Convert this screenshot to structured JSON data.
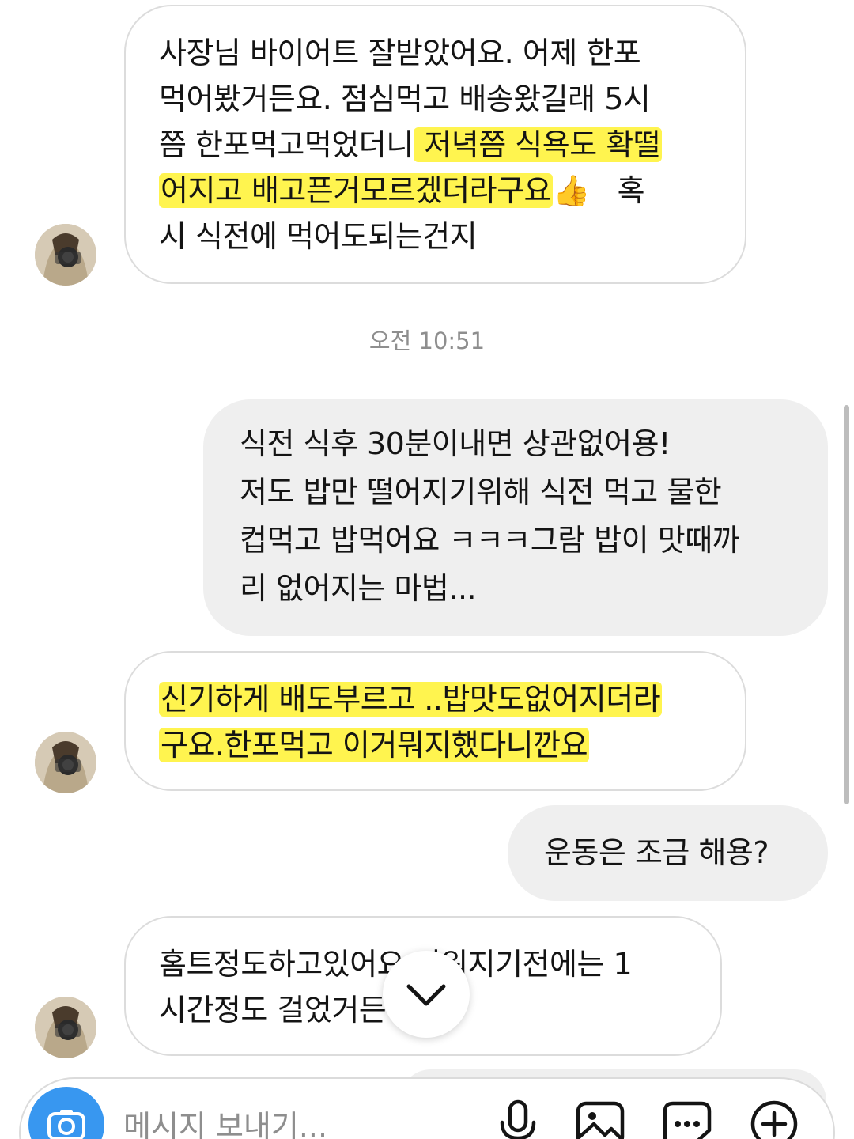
{
  "messages": [
    {
      "lines": [
        {
          "text": "사장님 바이어트 잘받았어요. 어제 한포"
        },
        {
          "text": "먹어봤거든요. 점심먹고  배송왔길래 5시"
        },
        {
          "pre": "쯤 한포먹고먹었더니",
          "hl": " 저녁쯤 식욕도 확떨"
        },
        {
          "hl": "어지고 배고픈거모르겠더라구요",
          "emoji": "👍",
          "post": "   혹"
        },
        {
          "text": "시 식전에 먹어도되는건지"
        }
      ]
    },
    {
      "lines": [
        {
          "text": "식전 식후 30분이내면 상관없어용!"
        },
        {
          "text": "저도 밥만 떨어지기위해 식전 먹고 물한"
        },
        {
          "text": "컵먹고 밥먹어요 ㅋㅋㅋ그람 밥이 맛때까"
        },
        {
          "text": "리 없어지는 마법..."
        }
      ]
    },
    {
      "lines": [
        {
          "hl": "신기하게 배도부르고 ..밥맛도없어지더라"
        },
        {
          "hl": "구요.한포먹고 이거뭐지했다니깐요"
        }
      ]
    },
    {
      "lines": [
        {
          "text": "운동은 조금 해용?"
        }
      ]
    },
    {
      "lines": [
        {
          "text": "홈트정도하고있어요  더워지기전에는 1"
        },
        {
          "text": "시간정도 걸었거든"
        }
      ]
    }
  ],
  "timestamp": "오전 10:51",
  "composer": {
    "placeholder": "메시지 보내기..."
  },
  "icons": {
    "camera": "camera-icon",
    "mic": "microphone-icon",
    "gallery": "image-gallery-icon",
    "sticker": "sticker-icon",
    "add": "plus-circle-icon",
    "scroll": "chevron-down-icon"
  },
  "colors": {
    "highlight": "#fff44f",
    "outgoing_bubble": "#efefef",
    "accent": "#3897f0",
    "timestamp": "#8e8e8e"
  }
}
